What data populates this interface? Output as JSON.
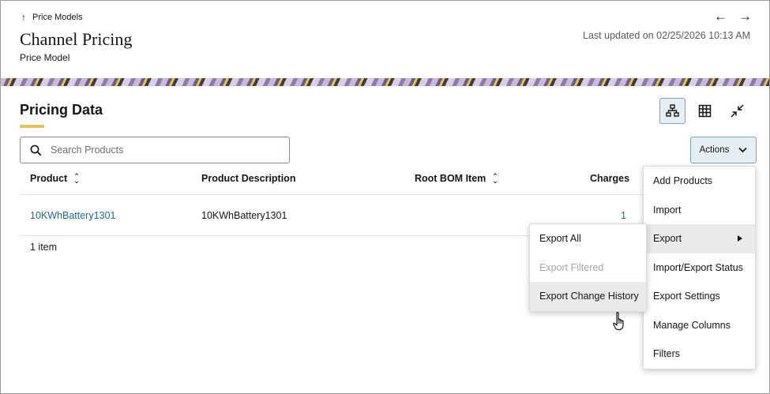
{
  "header": {
    "breadcrumb_label": "Price Models",
    "breadcrumb_icon": "arrow-up-icon",
    "title": "Channel Pricing",
    "subtitle": "Price Model",
    "last_updated": "Last updated on 02/25/2026 10:13 AM",
    "nav_back_icon": "arrow-left-icon",
    "nav_forward_icon": "arrow-right-icon"
  },
  "section": {
    "title": "Pricing Data",
    "accent_color": "#e3c15b",
    "view_tools": [
      {
        "icon": "hierarchy-view-icon",
        "active": true
      },
      {
        "icon": "table-view-icon",
        "active": false
      },
      {
        "icon": "collapse-icon",
        "active": false
      }
    ]
  },
  "search": {
    "placeholder": "Search Products",
    "value": ""
  },
  "actions": {
    "label": "Actions",
    "menu": [
      {
        "label": "Add Products"
      },
      {
        "label": "Import"
      },
      {
        "label": "Export",
        "has_submenu": true,
        "highlighted": true
      },
      {
        "label": "Import/Export Status"
      },
      {
        "label": "Export Settings"
      },
      {
        "label": "Manage Columns"
      },
      {
        "label": "Filters"
      }
    ],
    "export_submenu": [
      {
        "label": "Export All",
        "disabled": false
      },
      {
        "label": "Export Filtered",
        "disabled": true
      },
      {
        "label": "Export Change History",
        "disabled": false,
        "highlighted": true
      }
    ]
  },
  "table": {
    "columns": [
      {
        "label": "Product",
        "sortable": true
      },
      {
        "label": "Product Description",
        "sortable": false
      },
      {
        "label": "Root BOM Item",
        "sortable": true
      },
      {
        "label": "Charges",
        "sortable": false
      }
    ],
    "rows": [
      {
        "product": "10KWhBattery1301",
        "description": "10KWhBattery1301",
        "root_bom_item": "",
        "charges": "1"
      }
    ],
    "count_label": "1 item"
  },
  "colors": {
    "link": "#1e6c8e",
    "active_tool_bg": "#e4eef3",
    "active_tool_border": "#7aa5bd"
  }
}
